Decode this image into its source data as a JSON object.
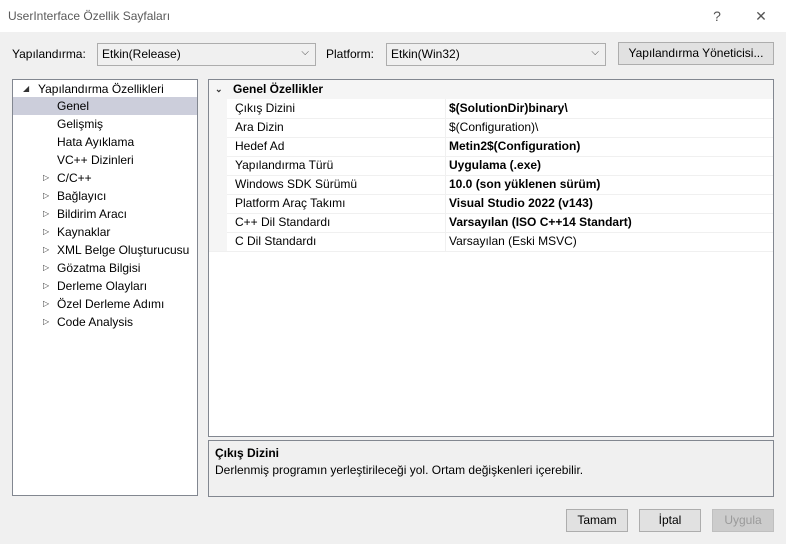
{
  "window": {
    "title": "UserInterface Özellik Sayfaları",
    "help": "?",
    "close": "✕"
  },
  "config": {
    "config_label": "Yapılandırma:",
    "config_value": "Etkin(Release)",
    "platform_label": "Platform:",
    "platform_value": "Etkin(Win32)",
    "manager_button": "Yapılandırma Yöneticisi..."
  },
  "tree": {
    "root": "Yapılandırma Özellikleri",
    "items": [
      "Genel",
      "Gelişmiş",
      "Hata Ayıklama",
      "VC++ Dizinleri",
      "C/C++",
      "Bağlayıcı",
      "Bildirim Aracı",
      "Kaynaklar",
      "XML Belge Oluşturucusu",
      "Gözatma Bilgisi",
      "Derleme Olayları",
      "Özel Derleme Adımı",
      "Code Analysis"
    ]
  },
  "grid": {
    "category": "Genel Özellikler",
    "rows": [
      {
        "name": "Çıkış Dizini",
        "value": "$(SolutionDir)binary\\"
      },
      {
        "name": "Ara Dizin",
        "value": "$(Configuration)\\"
      },
      {
        "name": "Hedef Ad",
        "value": "Metin2$(Configuration)"
      },
      {
        "name": "Yapılandırma Türü",
        "value": "Uygulama (.exe)"
      },
      {
        "name": "Windows SDK Sürümü",
        "value": "10.0 (son yüklenen sürüm)"
      },
      {
        "name": "Platform Araç Takımı",
        "value": "Visual Studio 2022 (v143)"
      },
      {
        "name": "C++ Dil Standardı",
        "value": "Varsayılan (ISO C++14 Standart)"
      },
      {
        "name": "C Dil Standardı",
        "value": "Varsayılan (Eski MSVC)"
      }
    ]
  },
  "description": {
    "title": "Çıkış Dizini",
    "text": "Derlenmiş programın yerleştirileceği yol. Ortam değişkenleri içerebilir."
  },
  "buttons": {
    "ok": "Tamam",
    "cancel": "İptal",
    "apply": "Uygula"
  },
  "icons": {
    "expanded": "expanded-triangle-icon",
    "collapsed": "collapsed-triangle-icon",
    "dropdown": "chevron-down-icon"
  }
}
